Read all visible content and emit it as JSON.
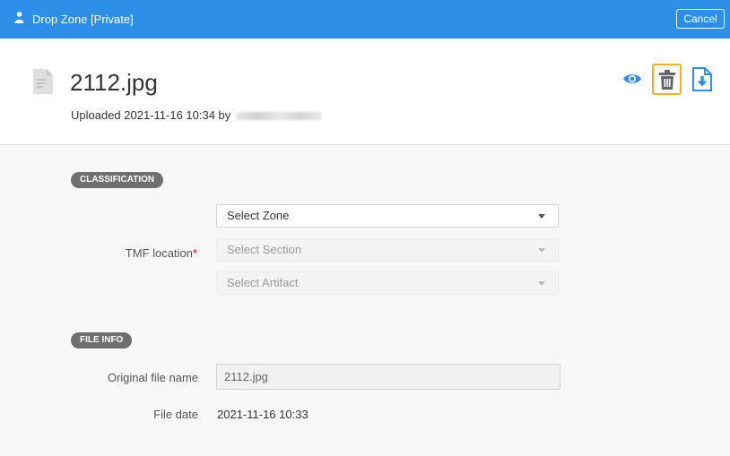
{
  "titlebar": {
    "title": "Drop Zone [Private]",
    "cancel_label": "Cancel",
    "icon": "person-icon"
  },
  "document": {
    "name": "2112.jpg",
    "uploaded_prefix": "Uploaded 2021-11-16 10:34 by",
    "uploader_redacted": true,
    "actions": [
      "eye-icon",
      "trash-icon",
      "download-icon"
    ]
  },
  "classification": {
    "badge": "CLASSIFICATION",
    "tmf_label": "TMF location",
    "required_mark": "*",
    "zone_value": "Select Zone",
    "section_placeholder": "Select Section",
    "artifact_placeholder": "Select Artifact"
  },
  "file_info": {
    "badge": "FILE INFO",
    "original_name_label": "Original file name",
    "original_name_value": "2112.jpg",
    "file_date_label": "File date",
    "file_date_value": "2021-11-16 10:33"
  },
  "colors": {
    "titlebar": "#2d8ee8",
    "highlight": "#f3b21a",
    "eye": "#2d8ee8",
    "badge": "#6f6f6f"
  }
}
